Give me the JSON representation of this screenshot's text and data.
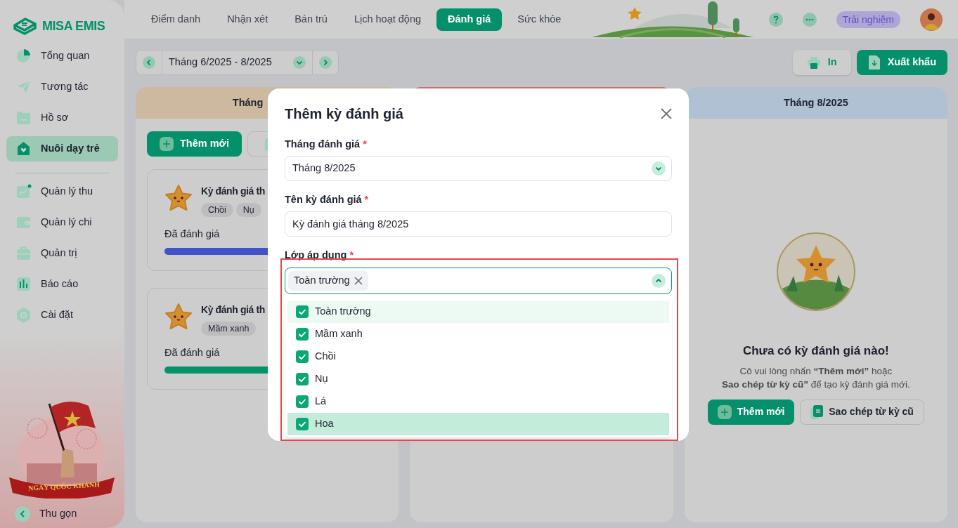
{
  "brand": "MISA EMIS",
  "sidebar": {
    "groups": [
      [
        {
          "label": "Tổng quan",
          "selected": false
        },
        {
          "label": "Tương tác",
          "selected": false
        },
        {
          "label": "Hồ sơ",
          "selected": false
        },
        {
          "label": "Nuôi dạy trẻ",
          "selected": true
        }
      ],
      [
        {
          "label": "Quản lý thu",
          "selected": false
        },
        {
          "label": "Quản lý chi",
          "selected": false
        },
        {
          "label": "Quản trị",
          "selected": false
        },
        {
          "label": "Báo cáo",
          "selected": false
        },
        {
          "label": "Cài đặt",
          "selected": false
        }
      ]
    ],
    "banner": {
      "text": "NGÀY QUỐC KHÁNH"
    },
    "collapse": "Thu gọn"
  },
  "top_tabs": [
    {
      "label": "Điểm danh",
      "selected": false
    },
    {
      "label": "Nhận xét",
      "selected": false
    },
    {
      "label": "Bán trú",
      "selected": false
    },
    {
      "label": "Lịch hoạt động",
      "selected": false
    },
    {
      "label": "Đánh giá",
      "selected": true
    },
    {
      "label": "Sức khỏe",
      "selected": false
    }
  ],
  "header": {
    "trial_badge": "Trải nghiệm"
  },
  "toolbar": {
    "period": "Tháng 6/2025 - 8/2025",
    "print": "In",
    "export": "Xuất khẩu"
  },
  "columns": [
    {
      "kind": "list",
      "header": "Tháng",
      "color": "#cdb9a0",
      "add_button": "Thêm mới",
      "cards": [
        {
          "title": "Kỳ đánh giá th",
          "tags": [
            "Chồi",
            "Nụ"
          ],
          "status": "Đã đánh giá",
          "level": 1,
          "color": "#4452c8"
        },
        {
          "title": "Kỳ đánh giá th",
          "tags": [
            "Mầm xanh"
          ],
          "status": "Đã đánh giá",
          "level": 1,
          "color": "#03936b"
        }
      ]
    },
    {
      "kind": "hidden",
      "color": "#d46a6a"
    },
    {
      "kind": "empty",
      "header": "Tháng 8/2025",
      "color": "#b0c1d4",
      "title": "Chưa có kỳ đánh giá nào!",
      "message_lines": [
        "Cô vui lòng nhấn **“Thêm mới”** hoặc",
        "**Sao chép từ kỳ cũ”** để tạo kỳ đánh giá mới."
      ],
      "add_button": "Thêm mới",
      "copy_button": "Sao chép từ kỳ cũ"
    }
  ],
  "dialog": {
    "title": "Thêm kỳ đánh giá",
    "month_label": "Tháng đánh giá",
    "required_mark": "*",
    "month_value": "Tháng 8/2025",
    "name_label": "Tên kỳ đánh giá",
    "name_value": "Kỳ đánh giá tháng 8/2025",
    "class_label": "Lớp áp dụng",
    "class_tags": [
      "Toàn trường"
    ],
    "expanded": true,
    "options": [
      {
        "label": "Toàn trường",
        "checked": true,
        "focused": true,
        "selected": false
      },
      {
        "label": "Mầm xanh",
        "checked": true,
        "focused": false,
        "selected": false
      },
      {
        "label": "Chồi",
        "checked": true,
        "focused": false,
        "selected": false
      },
      {
        "label": "Nụ",
        "checked": true,
        "focused": false,
        "selected": false
      },
      {
        "label": "Lá",
        "checked": true,
        "focused": false,
        "selected": false
      },
      {
        "label": "Hoa",
        "checked": true,
        "focused": false,
        "selected": true
      }
    ]
  }
}
